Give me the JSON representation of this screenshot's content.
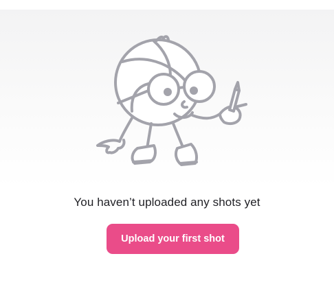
{
  "empty_state": {
    "illustration": "cartoon-ball-character-with-glasses-and-pencil",
    "message": "You haven’t uploaded any shots yet",
    "cta_label": "Upload your first shot"
  },
  "colors": {
    "accent": "#ea4c89",
    "text": "#1f1f24",
    "illustration_stroke": "#a3a3ab"
  }
}
